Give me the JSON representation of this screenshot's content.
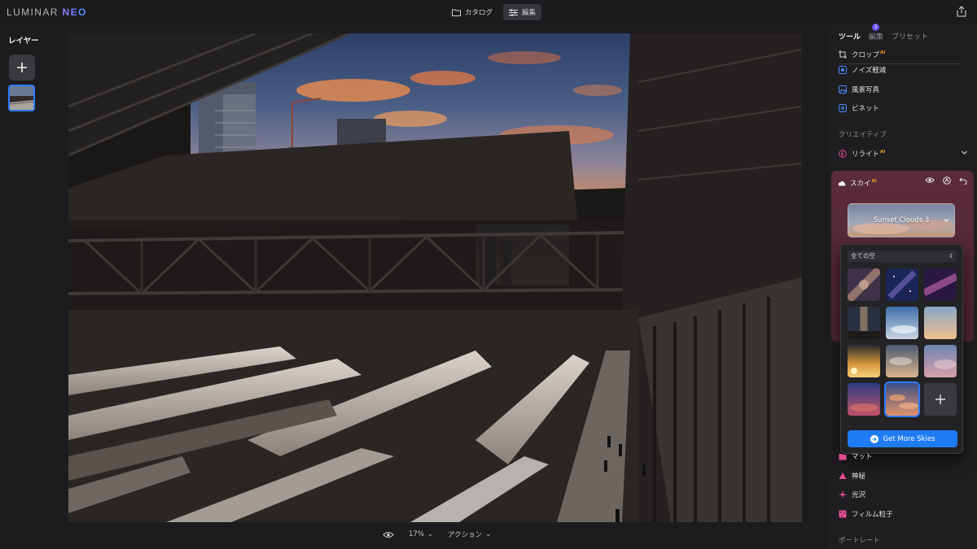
{
  "app": {
    "logo_main": "LUMINAR",
    "logo_accent": "NEO"
  },
  "topnav": {
    "catalog_label": "カタログ",
    "edit_label": "編集"
  },
  "layers": {
    "title": "レイヤー"
  },
  "bottom_bar": {
    "zoom": "17%",
    "actions": "アクション"
  },
  "panel": {
    "tabs": [
      {
        "label": "ツール"
      },
      {
        "label": "編集",
        "badge": "3"
      },
      {
        "label": "プリセット"
      }
    ],
    "tools": [
      {
        "label": "クロップ",
        "ai": "AI"
      },
      {
        "label": "ノイズ軽減"
      },
      {
        "label": "風景写真"
      },
      {
        "label": "ビネット"
      }
    ],
    "creative_label": "クリエイティブ",
    "relight": {
      "label": "リライト",
      "ai": "AI"
    },
    "sky": {
      "label": "スカイ",
      "ai": "AI",
      "selected_sky": "Sunset Clouds 3"
    },
    "sky_popup": {
      "filter_value": "全ての空",
      "get_more": "Get More Skies"
    },
    "bottom_items": [
      {
        "label": "マット"
      },
      {
        "label": "神秘"
      },
      {
        "label": "光沢"
      },
      {
        "label": "フィルム粒子"
      }
    ],
    "portrait_label": "ポートレート"
  },
  "colors": {
    "accent": "#1f7bf2",
    "ai_badge": "#f39a2b",
    "sky_card": "#5b2c3b",
    "selection": "#2f7bff"
  }
}
